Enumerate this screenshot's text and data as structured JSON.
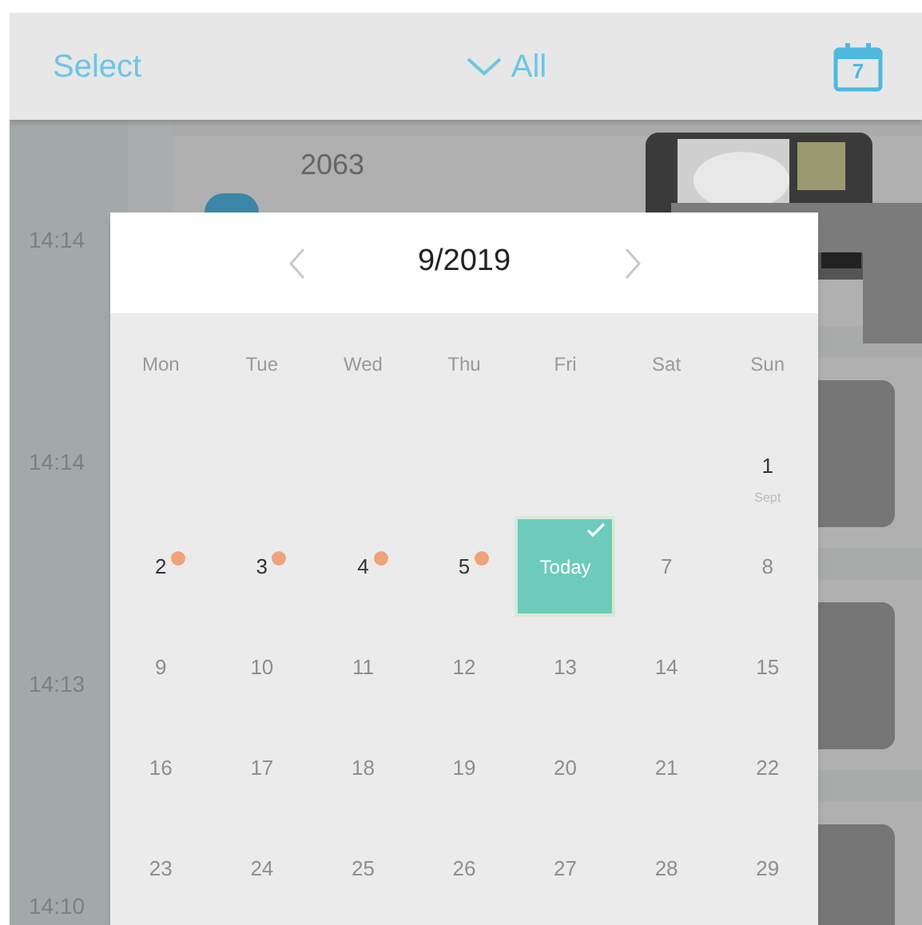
{
  "top_bar": {
    "select_label": "Select",
    "filter_label": "All",
    "calendar_icon_day": "7"
  },
  "list": [
    {
      "time": "14:14",
      "title": "2063",
      "kind": "picture"
    },
    {
      "time": "14:14",
      "kind": "dark"
    },
    {
      "time": "14:13",
      "kind": "dark"
    },
    {
      "time": "14:10",
      "kind": "dark"
    }
  ],
  "calendar": {
    "month_label": "9/2019",
    "weekdays": [
      "Mon",
      "Tue",
      "Wed",
      "Thu",
      "Fri",
      "Sat",
      "Sun"
    ],
    "days": [
      {
        "kind": "blank"
      },
      {
        "kind": "blank"
      },
      {
        "kind": "blank"
      },
      {
        "kind": "blank"
      },
      {
        "kind": "blank"
      },
      {
        "kind": "blank"
      },
      {
        "kind": "past",
        "label": "1",
        "sublabel": "Sept",
        "has_event": false,
        "selected": false
      },
      {
        "kind": "past",
        "label": "2",
        "has_event": true,
        "selected": false
      },
      {
        "kind": "past",
        "label": "3",
        "has_event": true,
        "selected": false
      },
      {
        "kind": "past",
        "label": "4",
        "has_event": true,
        "selected": false
      },
      {
        "kind": "past",
        "label": "5",
        "has_event": true,
        "selected": false
      },
      {
        "kind": "today",
        "label": "Today",
        "selected": true
      },
      {
        "kind": "future",
        "label": "7",
        "has_event": false,
        "selected": false
      },
      {
        "kind": "future",
        "label": "8",
        "has_event": false,
        "selected": false
      },
      {
        "kind": "future",
        "label": "9",
        "has_event": false,
        "selected": false
      },
      {
        "kind": "future",
        "label": "10",
        "has_event": false,
        "selected": false
      },
      {
        "kind": "future",
        "label": "11",
        "has_event": false,
        "selected": false
      },
      {
        "kind": "future",
        "label": "12",
        "has_event": false,
        "selected": false
      },
      {
        "kind": "future",
        "label": "13",
        "has_event": false,
        "selected": false
      },
      {
        "kind": "future",
        "label": "14",
        "has_event": false,
        "selected": false
      },
      {
        "kind": "future",
        "label": "15",
        "has_event": false,
        "selected": false
      },
      {
        "kind": "future",
        "label": "16",
        "has_event": false,
        "selected": false
      },
      {
        "kind": "future",
        "label": "17",
        "has_event": false,
        "selected": false
      },
      {
        "kind": "future",
        "label": "18",
        "has_event": false,
        "selected": false
      },
      {
        "kind": "future",
        "label": "19",
        "has_event": false,
        "selected": false
      },
      {
        "kind": "future",
        "label": "20",
        "has_event": false,
        "selected": false
      },
      {
        "kind": "future",
        "label": "21",
        "has_event": false,
        "selected": false
      },
      {
        "kind": "future",
        "label": "22",
        "has_event": false,
        "selected": false
      },
      {
        "kind": "future",
        "label": "23",
        "has_event": false,
        "selected": false
      },
      {
        "kind": "future",
        "label": "24",
        "has_event": false,
        "selected": false
      },
      {
        "kind": "future",
        "label": "25",
        "has_event": false,
        "selected": false
      },
      {
        "kind": "future",
        "label": "26",
        "has_event": false,
        "selected": false
      },
      {
        "kind": "future",
        "label": "27",
        "has_event": false,
        "selected": false
      },
      {
        "kind": "future",
        "label": "28",
        "has_event": false,
        "selected": false
      },
      {
        "kind": "future",
        "label": "29",
        "has_event": false,
        "selected": false
      }
    ]
  }
}
